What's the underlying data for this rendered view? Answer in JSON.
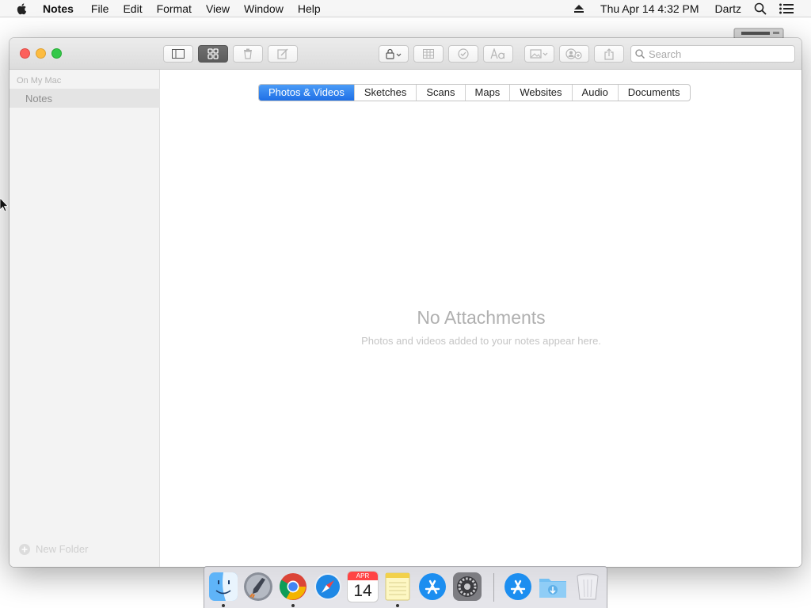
{
  "menubar": {
    "app_name": "Notes",
    "items": [
      "File",
      "Edit",
      "Format",
      "View",
      "Window",
      "Help"
    ],
    "clock": "Thu Apr 14  4:32 PM",
    "user": "Dartz"
  },
  "window": {
    "search": {
      "placeholder": "Search"
    },
    "sidebar": {
      "section": "On My Mac",
      "folder": "Notes",
      "new_folder": "New Folder"
    },
    "attachments": {
      "tabs": [
        {
          "label": "Photos & Videos",
          "active": true
        },
        {
          "label": "Sketches",
          "active": false
        },
        {
          "label": "Scans",
          "active": false
        },
        {
          "label": "Maps",
          "active": false
        },
        {
          "label": "Websites",
          "active": false
        },
        {
          "label": "Audio",
          "active": false
        },
        {
          "label": "Documents",
          "active": false
        }
      ],
      "empty_title": "No Attachments",
      "empty_subtitle": "Photos and videos added to your notes appear here."
    }
  },
  "dock": {
    "calendar": {
      "month": "APR",
      "day": "14"
    },
    "apps": [
      "finder",
      "launchpad",
      "chrome",
      "safari",
      "calendar",
      "notes",
      "app-store",
      "system-preferences",
      "app-store-downloads",
      "downloads-folder",
      "trash"
    ]
  },
  "colors": {
    "accent": "#1f6fe6",
    "close": "#fc605b",
    "minimize": "#fdbc40",
    "maximize": "#34c84a"
  }
}
